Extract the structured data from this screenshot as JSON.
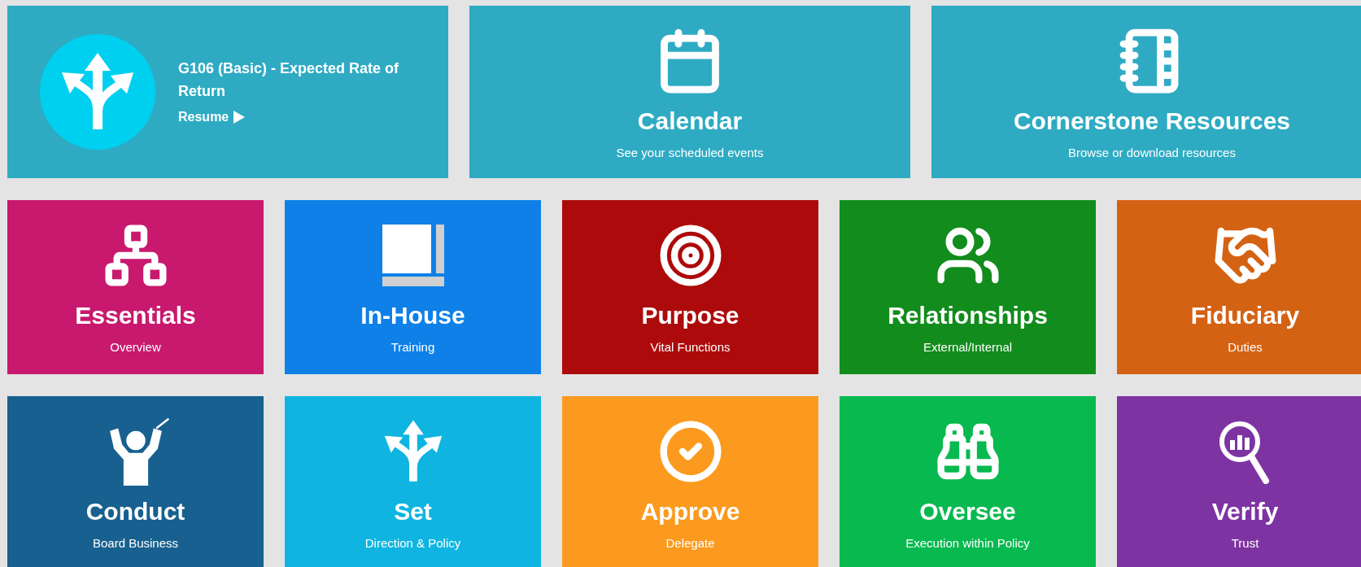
{
  "featured": {
    "title": "G106 (Basic) - Expected Rate of Return",
    "action": "Resume"
  },
  "cards": [
    {
      "title": "Calendar",
      "subtitle": "See your scheduled events"
    },
    {
      "title": "Cornerstone Resources",
      "subtitle": "Browse or download resources"
    }
  ],
  "tiles": [
    {
      "title": "Essentials",
      "subtitle": "Overview",
      "color": "#c8196e"
    },
    {
      "title": "In-House",
      "subtitle": "Training",
      "color": "#0e80e8"
    },
    {
      "title": "Purpose",
      "subtitle": "Vital Functions",
      "color": "#ad0b0b"
    },
    {
      "title": "Relationships",
      "subtitle": "External/Internal",
      "color": "#128c1c"
    },
    {
      "title": "Fiduciary",
      "subtitle": "Duties",
      "color": "#d46213"
    },
    {
      "title": "Conduct",
      "subtitle": "Board Business",
      "color": "#17608f"
    },
    {
      "title": "Set",
      "subtitle": "Direction & Policy",
      "color": "#0fb5e0"
    },
    {
      "title": "Approve",
      "subtitle": "Delegate",
      "color": "#fb9a1e"
    },
    {
      "title": "Oversee",
      "subtitle": "Execution within Policy",
      "color": "#08b94f"
    },
    {
      "title": "Verify",
      "subtitle": "Trust",
      "color": "#7d34a2"
    }
  ]
}
